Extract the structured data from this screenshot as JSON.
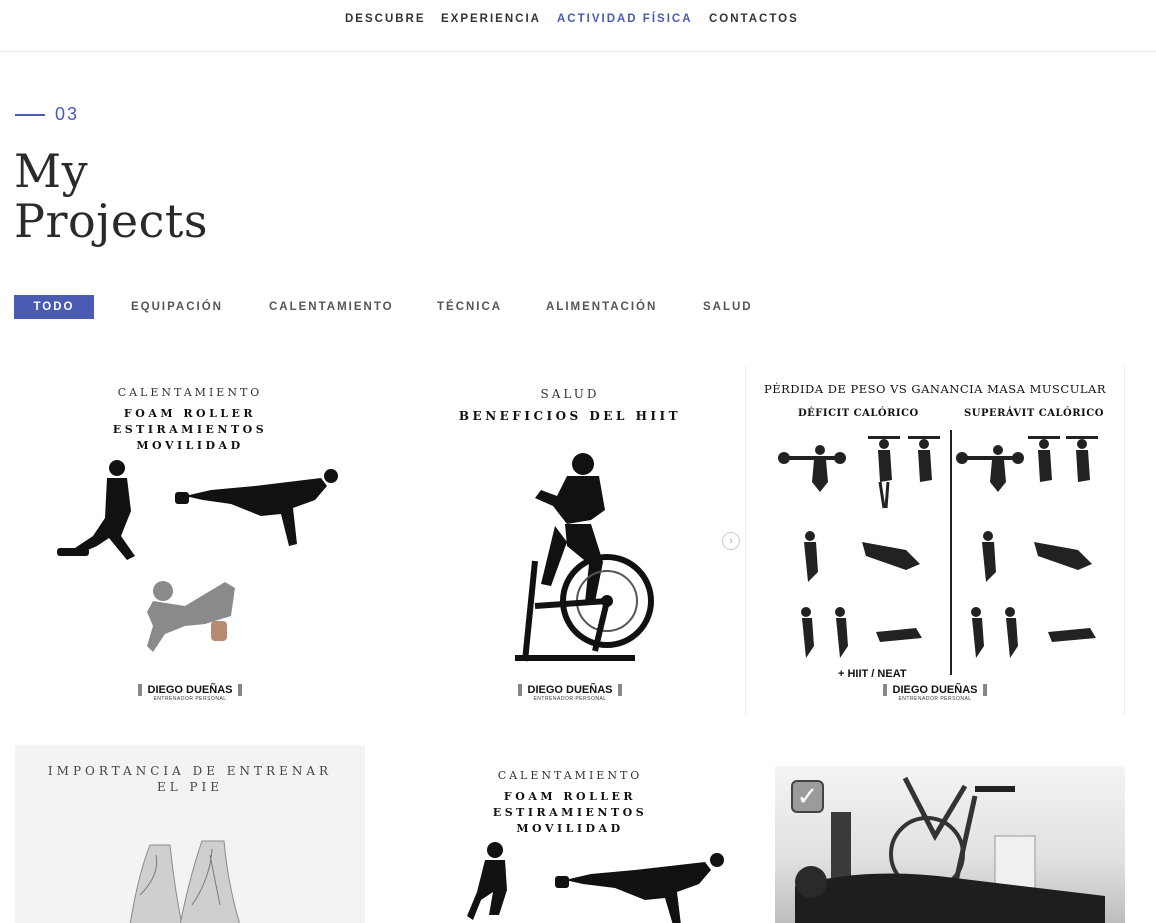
{
  "nav": {
    "items": [
      {
        "label": "DESCUBRE",
        "active": false
      },
      {
        "label": "EXPERIENCIA",
        "active": false
      },
      {
        "label": "ACTIVIDAD FÍSICA",
        "active": true
      },
      {
        "label": "CONTACTOS",
        "active": false
      }
    ]
  },
  "section": {
    "number": "03",
    "title_line1": "My",
    "title_line2": "Projects"
  },
  "filters": [
    "TODO",
    "EQUIPACIÓN",
    "CALENTAMIENTO",
    "TÉCNICA",
    "ALIMENTACIÓN",
    "SALUD"
  ],
  "projects": {
    "p1": {
      "category": "CALENTAMIENTO",
      "line1": "FOAM ROLLER",
      "line2": "ESTIRAMIENTOS",
      "line3": "MOVILIDAD",
      "brand": "DIEGO DUEÑAS",
      "brand_sub": "ENTRENADOR PERSONAL"
    },
    "p2": {
      "category": "SALUD",
      "line1": "BENEFICIOS DEL HIIT",
      "brand": "DIEGO DUEÑAS",
      "brand_sub": "ENTRENADOR PERSONAL"
    },
    "p3": {
      "title": "PÉRDIDA DE PESO VS GANANCIA MASA MUSCULAR",
      "left": "DÉFICIT CALÓRICO",
      "right": "SUPERÁVIT  CALÓRICO",
      "note": "+ HIIT / NEAT",
      "brand": "DIEGO DUEÑAS",
      "brand_sub": "ENTRENADOR PERSONAL"
    },
    "p4": {
      "line1": "Importancia de entrenar",
      "line2": "el pie"
    },
    "p5": {
      "category": "CALENTAMIENTO",
      "line1": "FOAM ROLLER",
      "line2": "ESTIRAMIENTOS",
      "line3": "MOVILIDAD"
    },
    "p6": {
      "check": "✓"
    }
  },
  "colors": {
    "accent": "#4a5bb3",
    "text": "#333333",
    "divider": "#ececec"
  }
}
